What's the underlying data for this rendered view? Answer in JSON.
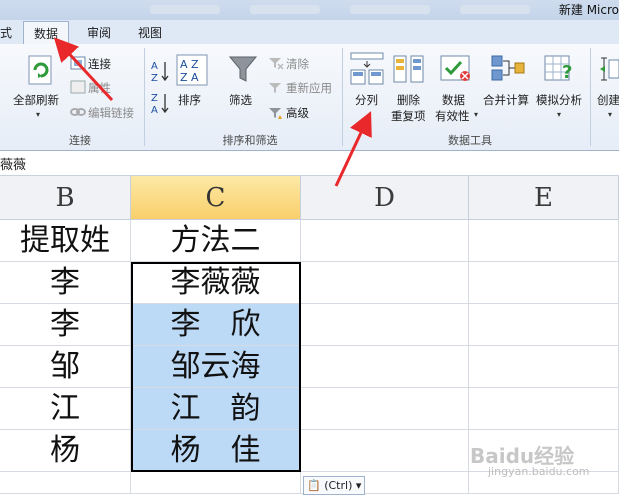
{
  "window": {
    "title": "新建 Micro"
  },
  "tabs": [
    {
      "label": "式"
    },
    {
      "label": "数据"
    },
    {
      "label": "审阅"
    },
    {
      "label": "视图"
    }
  ],
  "ribbon": {
    "connections": {
      "refresh_all": "全部刷新",
      "connections": "连接",
      "properties": "属性",
      "edit_links": "编辑链接",
      "group_label": "连接"
    },
    "sort_filter": {
      "sort": "排序",
      "filter": "筛选",
      "clear": "清除",
      "reapply": "重新应用",
      "advanced": "高级",
      "group_label": "排序和筛选"
    },
    "data_tools": {
      "text_to_columns": "分列",
      "remove_duplicates_1": "删除",
      "remove_duplicates_2": "重复项",
      "data_validation_1": "数据",
      "data_validation_2": "有效性",
      "consolidate": "合并计算",
      "what_if": "模拟分析",
      "group_label": "数据工具"
    },
    "outline": {
      "create": "创建"
    }
  },
  "formula_bar": {
    "value": "薇薇"
  },
  "columns": [
    "B",
    "C",
    "D",
    "E"
  ],
  "rows": [
    {
      "b": "提取姓",
      "c": "方法二"
    },
    {
      "b": "李",
      "c": "李薇薇"
    },
    {
      "b": "李",
      "c": "李　欣"
    },
    {
      "b": "邹",
      "c": "邹云海"
    },
    {
      "b": "江",
      "c": "江　韵"
    },
    {
      "b": "杨",
      "c": "杨　佳"
    }
  ],
  "paste_options": {
    "label": "(Ctrl)"
  },
  "watermark": {
    "text": "Baidu经验",
    "sub": "jingyan.baidu.com"
  },
  "colors": {
    "selected_fill": "#bcd9f6",
    "annotation_arrow": "#e8282b"
  }
}
